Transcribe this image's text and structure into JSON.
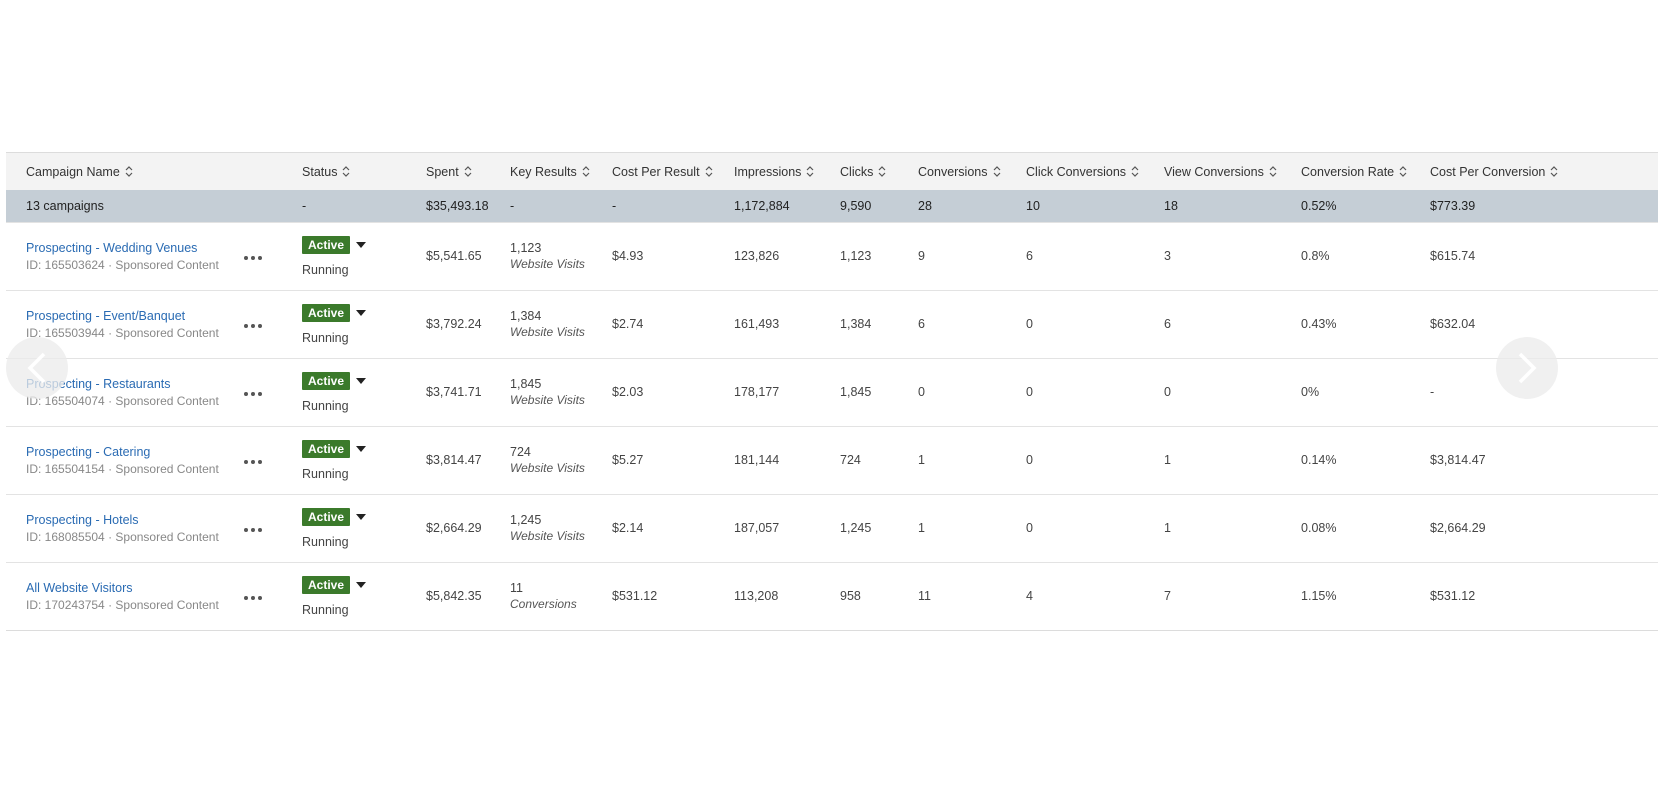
{
  "columns": [
    "Campaign Name",
    "Status",
    "Spent",
    "Key Results",
    "Cost Per Result",
    "Impressions",
    "Clicks",
    "Conversions",
    "Click Conversions",
    "View Conversions",
    "Conversion Rate",
    "Cost Per Conversion"
  ],
  "summary": {
    "label": "13 campaigns",
    "status": "-",
    "spent": "$35,493.18",
    "key_results": "-",
    "cost_per_result": "-",
    "impressions": "1,172,884",
    "clicks": "9,590",
    "conversions": "28",
    "click_conversions": "10",
    "view_conversions": "18",
    "conversion_rate": "0.52%",
    "cost_per_conversion": "$773.39"
  },
  "rows": [
    {
      "name": "Prospecting - Wedding Venues",
      "sub": "ID: 165503624 · Sponsored Content",
      "badge": "Active",
      "state": "Running",
      "spent": "$5,541.65",
      "kr_value": "1,123",
      "kr_type": "Website Visits",
      "cpr": "$4.93",
      "impressions": "123,826",
      "clicks": "1,123",
      "conversions": "9",
      "click_conv": "6",
      "view_conv": "3",
      "conv_rate": "0.8%",
      "cost_per_conv": "$615.74"
    },
    {
      "name": "Prospecting - Event/Banquet",
      "sub": "ID: 165503944 · Sponsored Content",
      "badge": "Active",
      "state": "Running",
      "spent": "$3,792.24",
      "kr_value": "1,384",
      "kr_type": "Website Visits",
      "cpr": "$2.74",
      "impressions": "161,493",
      "clicks": "1,384",
      "conversions": "6",
      "click_conv": "0",
      "view_conv": "6",
      "conv_rate": "0.43%",
      "cost_per_conv": "$632.04"
    },
    {
      "name": "Prospecting - Restaurants",
      "sub": "ID: 165504074 · Sponsored Content",
      "badge": "Active",
      "state": "Running",
      "spent": "$3,741.71",
      "kr_value": "1,845",
      "kr_type": "Website Visits",
      "cpr": "$2.03",
      "impressions": "178,177",
      "clicks": "1,845",
      "conversions": "0",
      "click_conv": "0",
      "view_conv": "0",
      "conv_rate": "0%",
      "cost_per_conv": "-"
    },
    {
      "name": "Prospecting - Catering",
      "sub": "ID: 165504154 · Sponsored Content",
      "badge": "Active",
      "state": "Running",
      "spent": "$3,814.47",
      "kr_value": "724",
      "kr_type": "Website Visits",
      "cpr": "$5.27",
      "impressions": "181,144",
      "clicks": "724",
      "conversions": "1",
      "click_conv": "0",
      "view_conv": "1",
      "conv_rate": "0.14%",
      "cost_per_conv": "$3,814.47"
    },
    {
      "name": "Prospecting - Hotels",
      "sub": "ID: 168085504 · Sponsored Content",
      "badge": "Active",
      "state": "Running",
      "spent": "$2,664.29",
      "kr_value": "1,245",
      "kr_type": "Website Visits",
      "cpr": "$2.14",
      "impressions": "187,057",
      "clicks": "1,245",
      "conversions": "1",
      "click_conv": "0",
      "view_conv": "1",
      "conv_rate": "0.08%",
      "cost_per_conv": "$2,664.29"
    },
    {
      "name": "All Website Visitors",
      "sub": "ID: 170243754 · Sponsored Content",
      "badge": "Active",
      "state": "Running",
      "spent": "$5,842.35",
      "kr_value": "11",
      "kr_type": "Conversions",
      "cpr": "$531.12",
      "impressions": "113,208",
      "clicks": "958",
      "conversions": "11",
      "click_conv": "4",
      "view_conv": "7",
      "conv_rate": "1.15%",
      "cost_per_conv": "$531.12"
    }
  ],
  "icons": {
    "sort": "sort-icon",
    "more": "more-options-icon",
    "status_dropdown": "caret-down-icon",
    "prev": "chevron-left-icon",
    "next": "chevron-right-icon"
  },
  "colors": {
    "link": "#2a6bb3",
    "active_badge": "#3b7a2b",
    "summary_row": "#c5ced6",
    "header_row": "#f3f3f3"
  }
}
